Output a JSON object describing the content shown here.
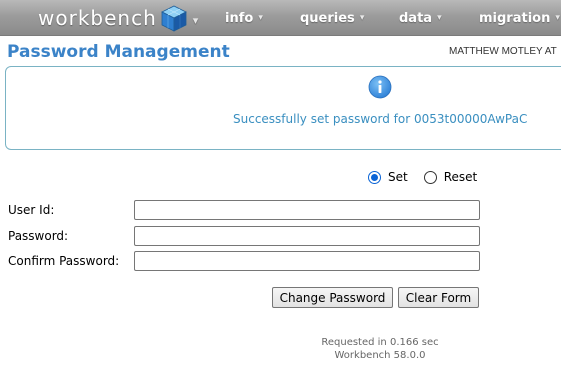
{
  "navbar": {
    "brand": "workbench",
    "items": [
      {
        "label": "info"
      },
      {
        "label": "queries"
      },
      {
        "label": "data"
      },
      {
        "label": "migration"
      }
    ],
    "caret": "▾"
  },
  "header": {
    "title": "Password Management",
    "user": "MATTHEW MOTLEY AT"
  },
  "message": {
    "icon": "info-icon",
    "text": "Successfully set password for 0053t00000AwPaC"
  },
  "mode": {
    "options": [
      {
        "label": "Set",
        "checked": true
      },
      {
        "label": "Reset",
        "checked": false
      }
    ]
  },
  "form": {
    "user_id_label": "User Id:",
    "user_id_value": "",
    "password_label": "Password:",
    "password_value": "",
    "confirm_label": "Confirm Password:",
    "confirm_value": ""
  },
  "buttons": {
    "change_password": "Change Password",
    "clear_form": "Clear Form"
  },
  "footer": {
    "requested": "Requested in 0.166 sec",
    "version": "Workbench 58.0.0"
  },
  "colors": {
    "title": "#3b83c8",
    "message": "#3a8fc0",
    "navbar": "#9c9c9c",
    "info_icon": "#3b8de0"
  }
}
